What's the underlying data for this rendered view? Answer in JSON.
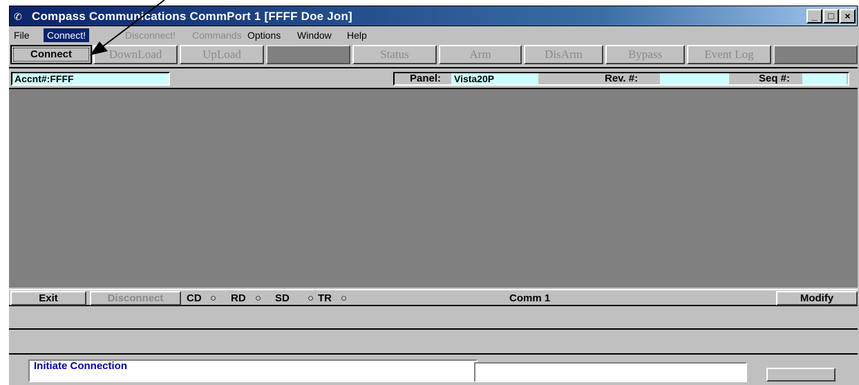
{
  "window": {
    "title": "Compass Communications CommPort 1 [FFFF Doe Jon]",
    "icon": "phone-handset-icon",
    "controls": {
      "minimize": "_",
      "maximize": "□",
      "close": "×"
    }
  },
  "menu": [
    {
      "label": "File",
      "state": "normal"
    },
    {
      "label": "Connect!",
      "state": "active"
    },
    {
      "label": "Disconnect!",
      "state": "disabled"
    },
    {
      "label": "Commands",
      "state": "disabled"
    },
    {
      "label": "Options",
      "state": "normal"
    },
    {
      "label": "Window",
      "state": "normal"
    },
    {
      "label": "Help",
      "state": "normal"
    }
  ],
  "toolbar": {
    "connect": "Connect",
    "download": "DownLoad",
    "upload": "UpLoad",
    "status": "Status",
    "arm": "Arm",
    "disarm": "DisArm",
    "bypass": "Bypass",
    "event_log": "Event Log"
  },
  "info": {
    "account_label": "Accnt#:",
    "account_value": "FFFF",
    "panel_label": "Panel:",
    "panel_value": "Vista20P",
    "rev_label": "Rev. #:",
    "rev_value": "",
    "seq_label": "Seq #:",
    "seq_value": ""
  },
  "status_bar": {
    "exit": "Exit",
    "disconnect": "Disconnect",
    "cd": "CD",
    "rd": "RD",
    "sd": "SD",
    "tr": "TR",
    "indicator": "○",
    "comm": "Comm 1",
    "modify": "Modify"
  },
  "message": {
    "text": "Initiate Connection"
  },
  "colors": {
    "title_gradient_start": "#0a246a",
    "field_background": "#ccffff",
    "work_area": "#808080",
    "message_text": "#0000aa"
  }
}
